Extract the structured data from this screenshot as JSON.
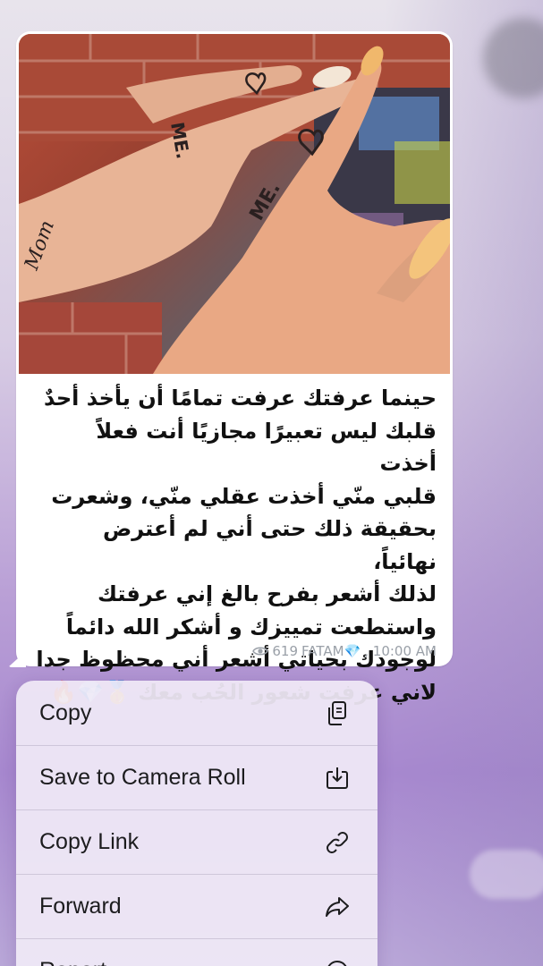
{
  "message": {
    "lines": [
      "حينما عرفتك عرفت تمامًا أن يأخذ أحدٌ",
      "قلبك ليس تعبيرًا مجازيًا أنت فعلاً أخذت",
      "قلبي منّي أخذت عقلي منّي، وشعرت",
      "بحقيقة ذلك حتى أني لم أعترض نهائياً،",
      "لذلك أشعر بفرح بالغ إني عرفتك",
      "واستطعت تمييزك و أشكر الله دائماً",
      "لوجودك بحياتي أشعر أني محظوظ جدا",
      "لاني عرفت شعور الحُب معك 🥇💎🔥"
    ],
    "views": "619",
    "author": "FATAM💎",
    "time": ", 10:00 AM"
  },
  "photo": {
    "tattoo_text_1": "ME.",
    "tattoo_text_2": "ME.",
    "tattoo_text_3": "Mom"
  },
  "menu": {
    "items": [
      {
        "label": "Copy",
        "icon": "copy-icon"
      },
      {
        "label": "Save to Camera Roll",
        "icon": "save-download-icon"
      },
      {
        "label": "Copy Link",
        "icon": "link-icon"
      },
      {
        "label": "Forward",
        "icon": "forward-arrow-icon"
      },
      {
        "label": "Report",
        "icon": "report-icon"
      }
    ]
  },
  "colors": {
    "menu_background": "#f0eaf6",
    "bubble_background": "#ffffff",
    "meta_text": "#9aa0a8"
  }
}
